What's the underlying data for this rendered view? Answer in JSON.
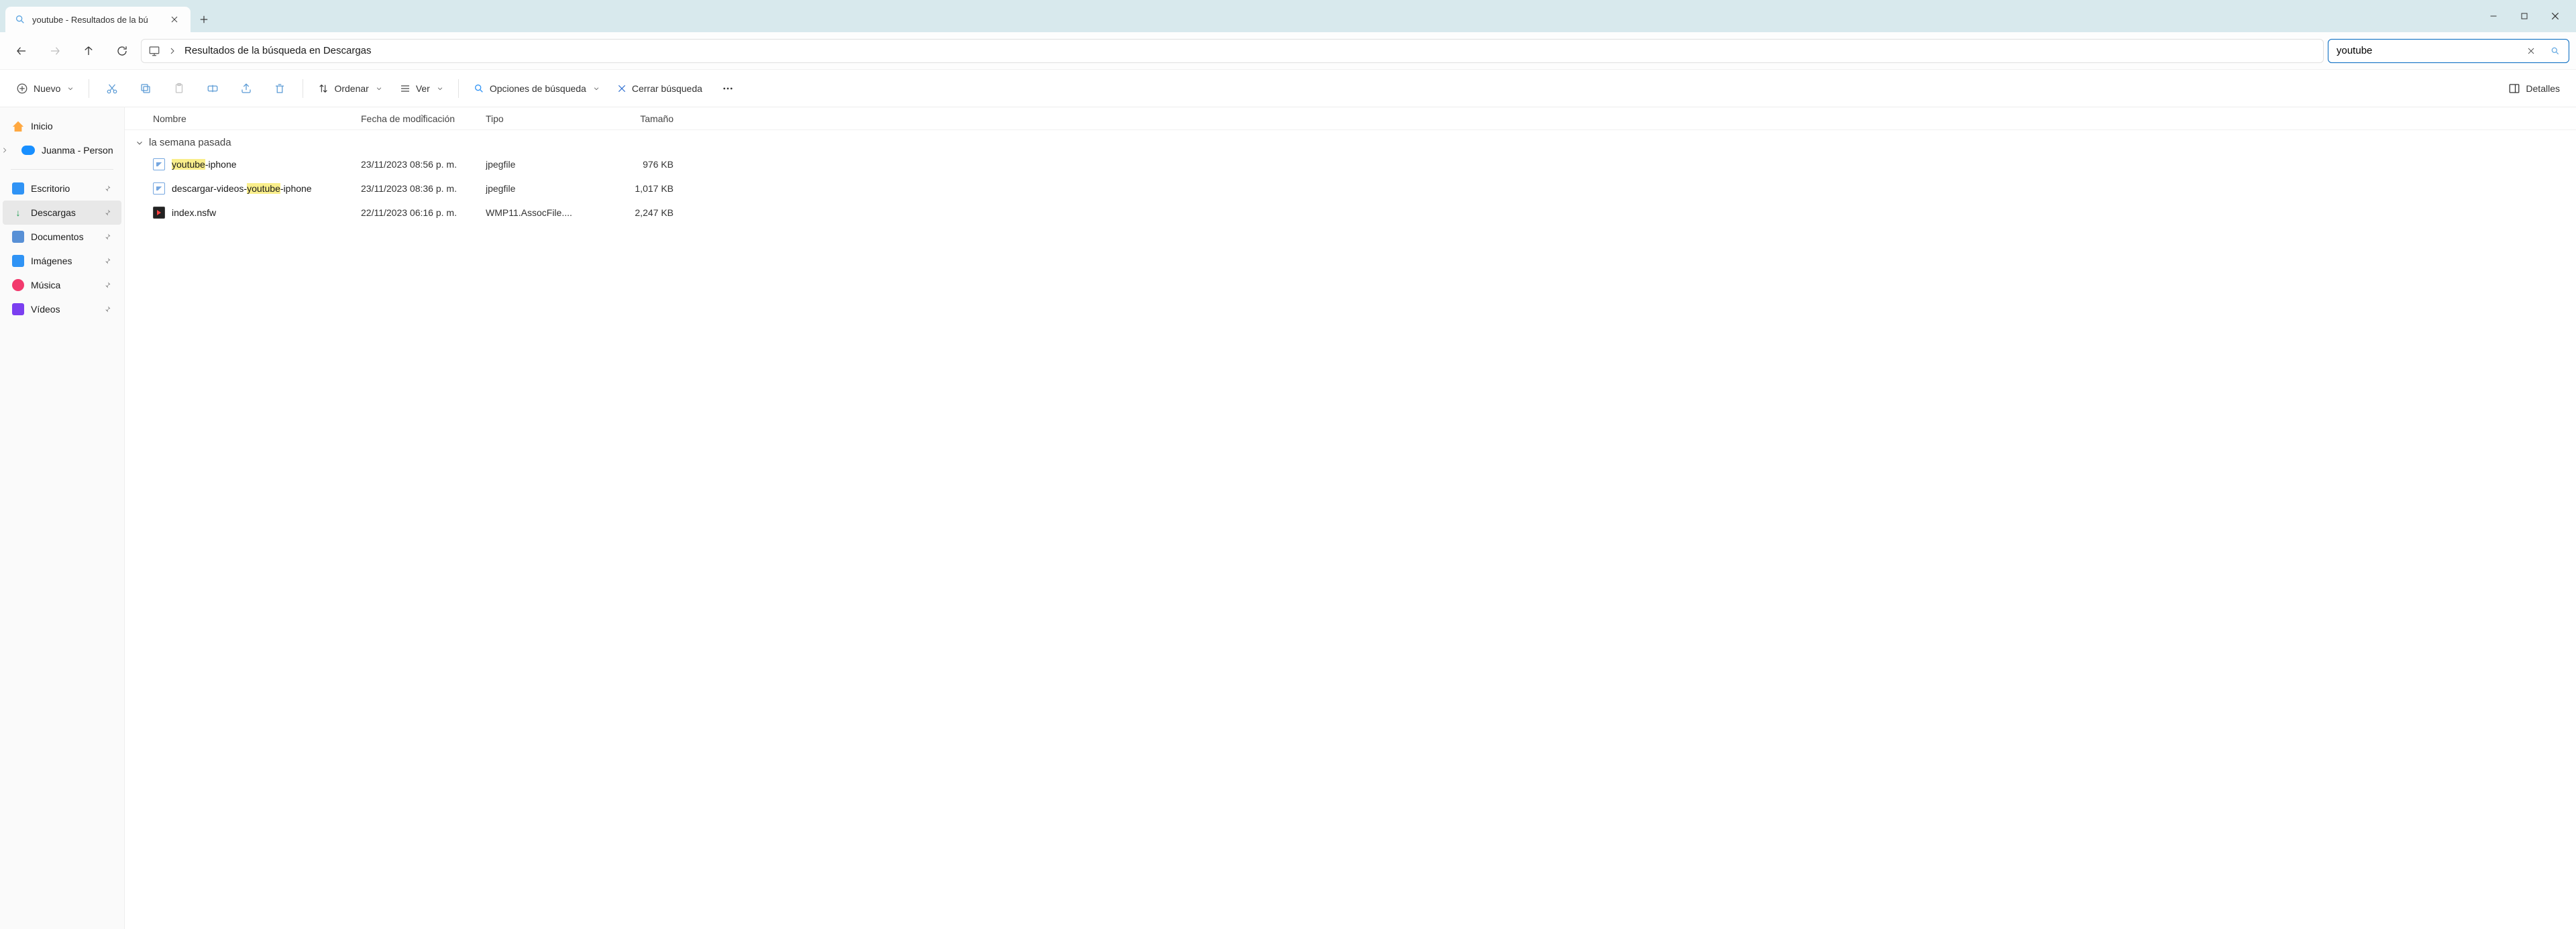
{
  "tab": {
    "title": "youtube - Resultados de la bú"
  },
  "address": {
    "crumb": "Resultados de la búsqueda en Descargas"
  },
  "search": {
    "value": "youtube"
  },
  "toolbar": {
    "new": "Nuevo",
    "sort": "Ordenar",
    "view": "Ver",
    "search_options": "Opciones de búsqueda",
    "close_search": "Cerrar búsqueda",
    "details": "Detalles"
  },
  "sidebar": {
    "home": "Inicio",
    "account": "Juanma - Person",
    "items": [
      {
        "label": "Escritorio"
      },
      {
        "label": "Descargas",
        "selected": true
      },
      {
        "label": "Documentos"
      },
      {
        "label": "Imágenes"
      },
      {
        "label": "Música"
      },
      {
        "label": "Vídeos"
      }
    ]
  },
  "columns": {
    "name": "Nombre",
    "date": "Fecha de modificación",
    "type": "Tipo",
    "size": "Tamaño"
  },
  "group": "la semana pasada",
  "highlight": "youtube",
  "files": [
    {
      "icon": "image",
      "name_parts": [
        "",
        "youtube",
        "-iphone"
      ],
      "date": "23/11/2023 08:56 p. m.",
      "type": "jpegfile",
      "size": "976 KB"
    },
    {
      "icon": "image",
      "name_parts": [
        "descargar-videos-",
        "youtube",
        "-iphone"
      ],
      "date": "23/11/2023 08:36 p. m.",
      "type": "jpegfile",
      "size": "1,017 KB"
    },
    {
      "icon": "video",
      "name_parts": [
        "index.nsfw",
        "",
        ""
      ],
      "date": "22/11/2023 06:16 p. m.",
      "type": "WMP11.AssocFile....",
      "size": "2,247 KB"
    }
  ]
}
